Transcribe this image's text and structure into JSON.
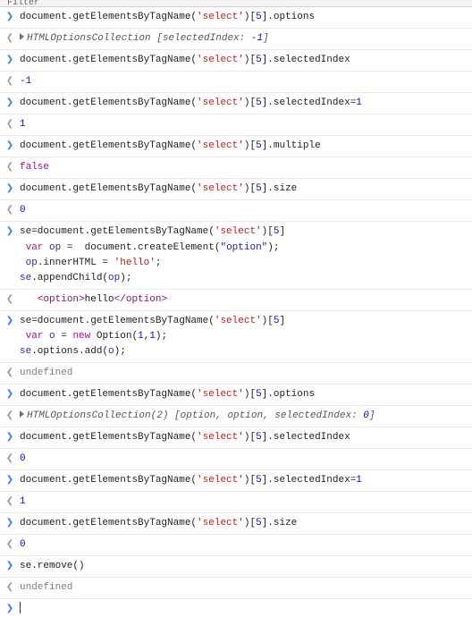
{
  "toolbar": {
    "filter": "Filter"
  },
  "rows": [
    {
      "dir": "in",
      "segs": [
        [
          "default",
          "document.getElementsByTagName("
        ],
        [
          "str",
          "'select'"
        ],
        [
          "default",
          ")["
        ],
        [
          "num",
          "5"
        ],
        [
          "default",
          "].options"
        ]
      ]
    },
    {
      "dir": "out",
      "disclosure": true,
      "segs": [
        [
          "italic",
          "HTMLOptionsCollection ["
        ],
        [
          "italic",
          "selectedIndex: "
        ],
        [
          "itnum",
          "-1"
        ],
        [
          "italic",
          "]"
        ]
      ]
    },
    {
      "dir": "in",
      "segs": [
        [
          "default",
          "document.getElementsByTagName("
        ],
        [
          "str",
          "'select'"
        ],
        [
          "default",
          ")["
        ],
        [
          "num",
          "5"
        ],
        [
          "default",
          "].selectedIndex"
        ]
      ]
    },
    {
      "dir": "out",
      "segs": [
        [
          "num",
          "-1"
        ]
      ]
    },
    {
      "dir": "in",
      "segs": [
        [
          "default",
          "document.getElementsByTagName("
        ],
        [
          "str",
          "'select'"
        ],
        [
          "default",
          ")["
        ],
        [
          "num",
          "5"
        ],
        [
          "default",
          "].selectedIndex="
        ],
        [
          "num",
          "1"
        ]
      ]
    },
    {
      "dir": "out",
      "segs": [
        [
          "num",
          "1"
        ]
      ]
    },
    {
      "dir": "in",
      "segs": [
        [
          "default",
          "document.getElementsByTagName("
        ],
        [
          "str",
          "'select'"
        ],
        [
          "default",
          ")["
        ],
        [
          "num",
          "5"
        ],
        [
          "default",
          "].multiple"
        ]
      ]
    },
    {
      "dir": "out",
      "segs": [
        [
          "kw",
          "false"
        ]
      ]
    },
    {
      "dir": "in",
      "segs": [
        [
          "default",
          "document.getElementsByTagName("
        ],
        [
          "str",
          "'select'"
        ],
        [
          "default",
          ")["
        ],
        [
          "num",
          "5"
        ],
        [
          "default",
          "].size"
        ]
      ]
    },
    {
      "dir": "out",
      "segs": [
        [
          "num",
          "0"
        ]
      ]
    },
    {
      "dir": "in",
      "segs": [
        [
          "default",
          "se=document.getElementsByTagName("
        ],
        [
          "str",
          "'select'"
        ],
        [
          "default",
          ")["
        ],
        [
          "num",
          "5"
        ],
        [
          "default",
          "]\n "
        ],
        [
          "kw",
          "var"
        ],
        [
          "default",
          " "
        ],
        [
          "obj",
          "op"
        ],
        [
          "default",
          " =  document.createElement("
        ],
        [
          "str2",
          "\"option\""
        ],
        [
          "default",
          ");\n "
        ],
        [
          "obj",
          "op"
        ],
        [
          "default",
          ".innerHTML = "
        ],
        [
          "str",
          "'hello'"
        ],
        [
          "default",
          ";\n"
        ],
        [
          "obj",
          "se"
        ],
        [
          "default",
          ".appendChild("
        ],
        [
          "obj",
          "op"
        ],
        [
          "default",
          ");"
        ]
      ]
    },
    {
      "dir": "out",
      "segs": [
        [
          "default",
          "   "
        ],
        [
          "tag",
          "<option>"
        ],
        [
          "text",
          "hello"
        ],
        [
          "tag",
          "</option>"
        ]
      ]
    },
    {
      "dir": "in",
      "segs": [
        [
          "default",
          "se=document.getElementsByTagName("
        ],
        [
          "str",
          "'select'"
        ],
        [
          "default",
          ")["
        ],
        [
          "num",
          "5"
        ],
        [
          "default",
          "]\n "
        ],
        [
          "kw",
          "var"
        ],
        [
          "default",
          " "
        ],
        [
          "obj",
          "o"
        ],
        [
          "default",
          " = "
        ],
        [
          "kw",
          "new"
        ],
        [
          "default",
          " Option("
        ],
        [
          "num",
          "1"
        ],
        [
          "default",
          ","
        ],
        [
          "num",
          "1"
        ],
        [
          "default",
          ");\n"
        ],
        [
          "obj",
          "se"
        ],
        [
          "default",
          ".options.add("
        ],
        [
          "obj",
          "o"
        ],
        [
          "default",
          ");"
        ]
      ]
    },
    {
      "dir": "out",
      "segs": [
        [
          "undef",
          "undefined"
        ]
      ]
    },
    {
      "dir": "in",
      "segs": [
        [
          "default",
          "document.getElementsByTagName("
        ],
        [
          "str",
          "'select'"
        ],
        [
          "default",
          ")["
        ],
        [
          "num",
          "5"
        ],
        [
          "default",
          "].options"
        ]
      ]
    },
    {
      "dir": "out",
      "disclosure": true,
      "segs": [
        [
          "italic",
          "HTMLOptionsCollection(2) ["
        ],
        [
          "italic",
          "option"
        ],
        [
          "italic",
          ", "
        ],
        [
          "italic",
          "option"
        ],
        [
          "italic",
          ", selectedIndex: "
        ],
        [
          "itnum",
          "0"
        ],
        [
          "italic",
          "]"
        ]
      ]
    },
    {
      "dir": "in",
      "segs": [
        [
          "default",
          "document.getElementsByTagName("
        ],
        [
          "str",
          "'select'"
        ],
        [
          "default",
          ")["
        ],
        [
          "num",
          "5"
        ],
        [
          "default",
          "].selectedIndex"
        ]
      ]
    },
    {
      "dir": "out",
      "segs": [
        [
          "num",
          "0"
        ]
      ]
    },
    {
      "dir": "in",
      "segs": [
        [
          "default",
          "document.getElementsByTagName("
        ],
        [
          "str",
          "'select'"
        ],
        [
          "default",
          ")["
        ],
        [
          "num",
          "5"
        ],
        [
          "default",
          "].selectedIndex="
        ],
        [
          "num",
          "1"
        ]
      ]
    },
    {
      "dir": "out",
      "segs": [
        [
          "num",
          "1"
        ]
      ]
    },
    {
      "dir": "in",
      "segs": [
        [
          "default",
          "document.getElementsByTagName("
        ],
        [
          "str",
          "'select'"
        ],
        [
          "default",
          ")["
        ],
        [
          "num",
          "5"
        ],
        [
          "default",
          "].size"
        ]
      ]
    },
    {
      "dir": "out",
      "segs": [
        [
          "num",
          "0"
        ]
      ]
    },
    {
      "dir": "in",
      "segs": [
        [
          "default",
          "se.remove()"
        ]
      ]
    },
    {
      "dir": "out",
      "segs": [
        [
          "undef",
          "undefined"
        ]
      ]
    }
  ]
}
